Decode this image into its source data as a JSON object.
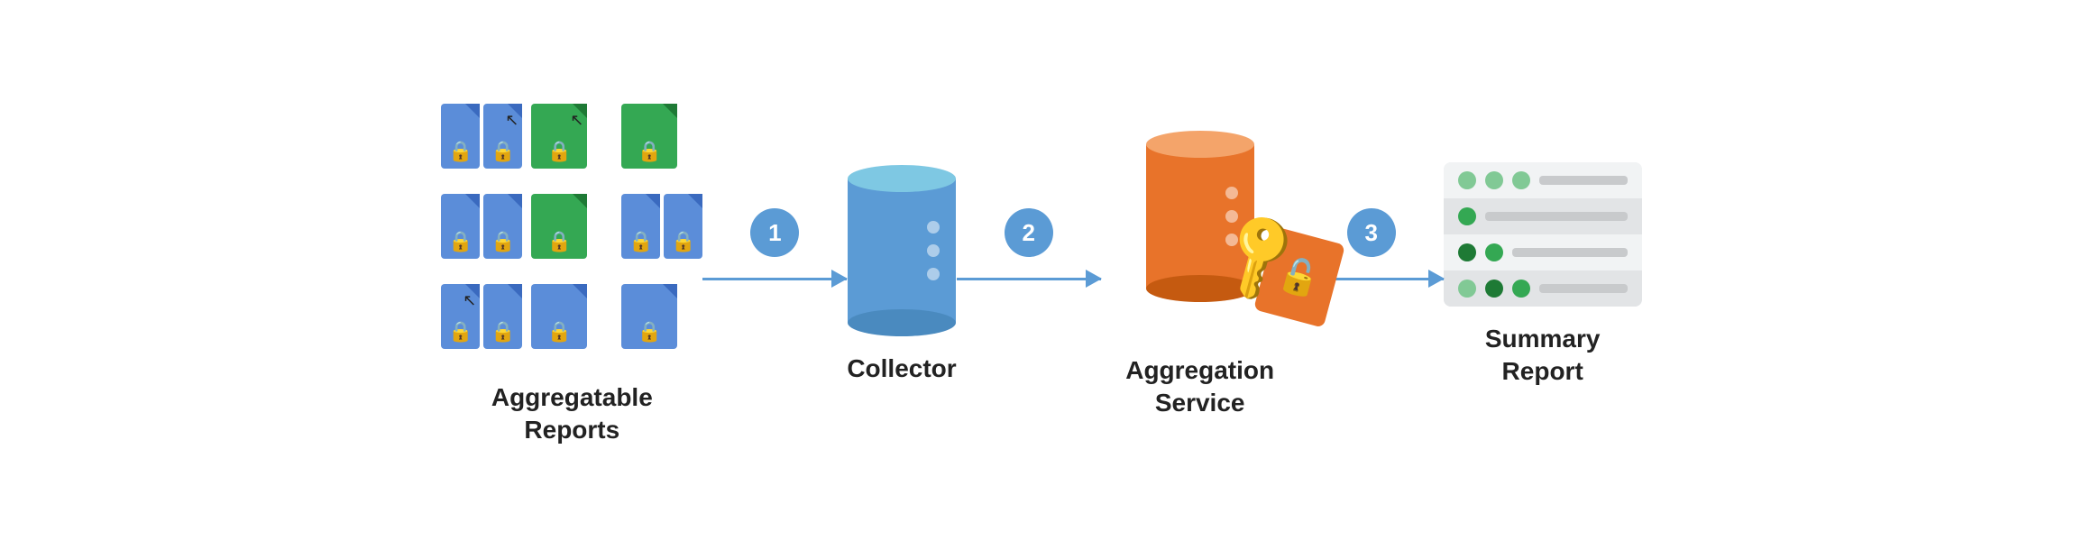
{
  "diagram": {
    "nodes": [
      {
        "id": "aggregatable-reports",
        "label_line1": "Aggregatable",
        "label_line2": "Reports"
      },
      {
        "id": "collector",
        "label_line1": "Collector",
        "label_line2": ""
      },
      {
        "id": "aggregation-service",
        "label_line1": "Aggregation",
        "label_line2": "Service"
      },
      {
        "id": "summary-report",
        "label_line1": "Summary",
        "label_line2": "Report"
      }
    ],
    "arrows": [
      {
        "id": "arrow-1",
        "step": "1"
      },
      {
        "id": "arrow-2",
        "step": "2"
      },
      {
        "id": "arrow-3",
        "step": "3"
      }
    ],
    "grid": {
      "items": [
        {
          "color": "blue",
          "has_cursor": false
        },
        {
          "color": "green",
          "has_cursor": true
        },
        {
          "color": "green",
          "has_cursor": false
        },
        {
          "color": "blue",
          "has_cursor": false
        },
        {
          "color": "green",
          "has_cursor": false
        },
        {
          "color": "blue",
          "has_cursor": false
        },
        {
          "color": "blue",
          "has_cursor": true
        },
        {
          "color": "blue",
          "has_cursor": false
        },
        {
          "color": "blue",
          "has_cursor": false
        }
      ]
    },
    "summary_rows": [
      {
        "dots": [
          "light",
          "light",
          "light"
        ],
        "line_width": "80%"
      },
      {
        "dots": [
          "mid"
        ],
        "line_width": "60%"
      },
      {
        "dots": [
          "dark",
          "mid"
        ],
        "line_width": "70%"
      },
      {
        "dots": [
          "light",
          "dark",
          "mid"
        ],
        "line_width": "50%"
      }
    ]
  }
}
